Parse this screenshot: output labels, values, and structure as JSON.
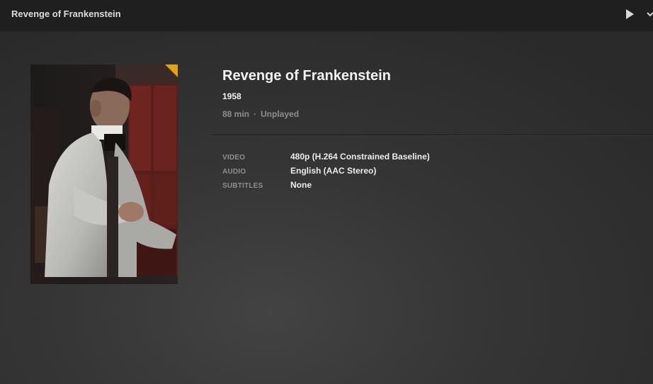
{
  "header": {
    "title": "Revenge of Frankenstein",
    "actions": [
      {
        "icon": "play-icon"
      },
      {
        "icon": "more-icon"
      }
    ]
  },
  "poster": {
    "badge_color": "#e5a00d"
  },
  "details": {
    "title": "Revenge of Frankenstein",
    "year": "1958",
    "duration": "88 min",
    "separator": "·",
    "status": "Unplayed"
  },
  "streams": [
    {
      "label": "VIDEO",
      "value": "480p (H.264 Constrained Baseline)"
    },
    {
      "label": "AUDIO",
      "value": "English (AAC Stereo)"
    },
    {
      "label": "SUBTITLES",
      "value": "None"
    }
  ],
  "colors": {
    "accent": "#e5a00d",
    "text_primary": "#f2f2f2",
    "text_muted": "#8e8e8e",
    "topbar": "#1f1f1f"
  }
}
